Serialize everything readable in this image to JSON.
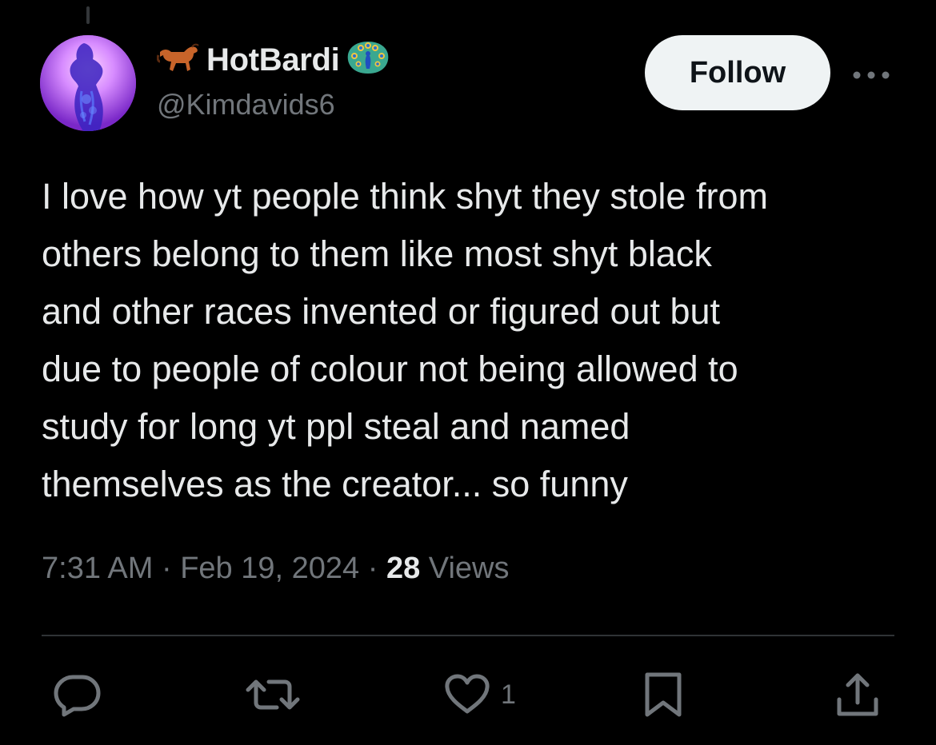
{
  "user": {
    "display_name": "HotBardi",
    "handle": "@Kimdavids6",
    "name_emoji_before": "horse",
    "name_emoji_after": "peacock"
  },
  "follow_label": "Follow",
  "tweet": {
    "text": "I love how yt people think shyt they stole from\nothers belong to them like most shyt black\nand other races invented or figured out but\ndue to people of colour not being allowed to\nstudy for long yt ppl steal and named\nthemselves as the creator... so funny"
  },
  "meta": {
    "time": "7:31 AM",
    "separator": " · ",
    "date": "Feb 19, 2024",
    "views_count": "28",
    "views_label": " Views"
  },
  "actions": {
    "reply_icon": "reply-icon",
    "retweet_icon": "retweet-icon",
    "like_icon": "heart-icon",
    "like_count": "1",
    "bookmark_icon": "bookmark-icon",
    "share_icon": "share-icon"
  },
  "colors": {
    "background": "#000000",
    "text": "#e7e9ea",
    "secondary": "#71767b",
    "divider": "#2f3336",
    "follow_bg": "#eff3f4"
  }
}
